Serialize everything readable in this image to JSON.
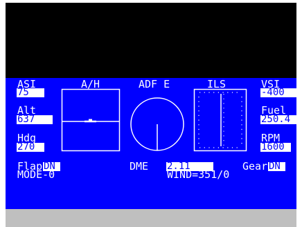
{
  "colors": {
    "background": "#0000ff",
    "foreground": "#ffffff",
    "sky": "#000000",
    "floor": "#bfbfbf"
  },
  "headers": {
    "asi": "ASI",
    "ah": "A/H",
    "adf": "ADF E",
    "ils": "ILS",
    "vsi": "VSI"
  },
  "readouts": {
    "asi_value": "75",
    "alt_label": "Alt",
    "alt_value": "637",
    "hdg_label": "Hdg",
    "hdg_value": "270",
    "vsi_value": "-400",
    "fuel_label": "Fuel",
    "fuel_value": "250.4",
    "rpm_label": "RPM",
    "rpm_value": "1600"
  },
  "status": {
    "flap_label": "Flap",
    "flap_value": "DN",
    "mode": "MODE-0",
    "dme_label": "DME",
    "dme_value": "2.11",
    "gear_label": "Gear",
    "gear_value": "DN",
    "wind": "WIND=351/0"
  }
}
